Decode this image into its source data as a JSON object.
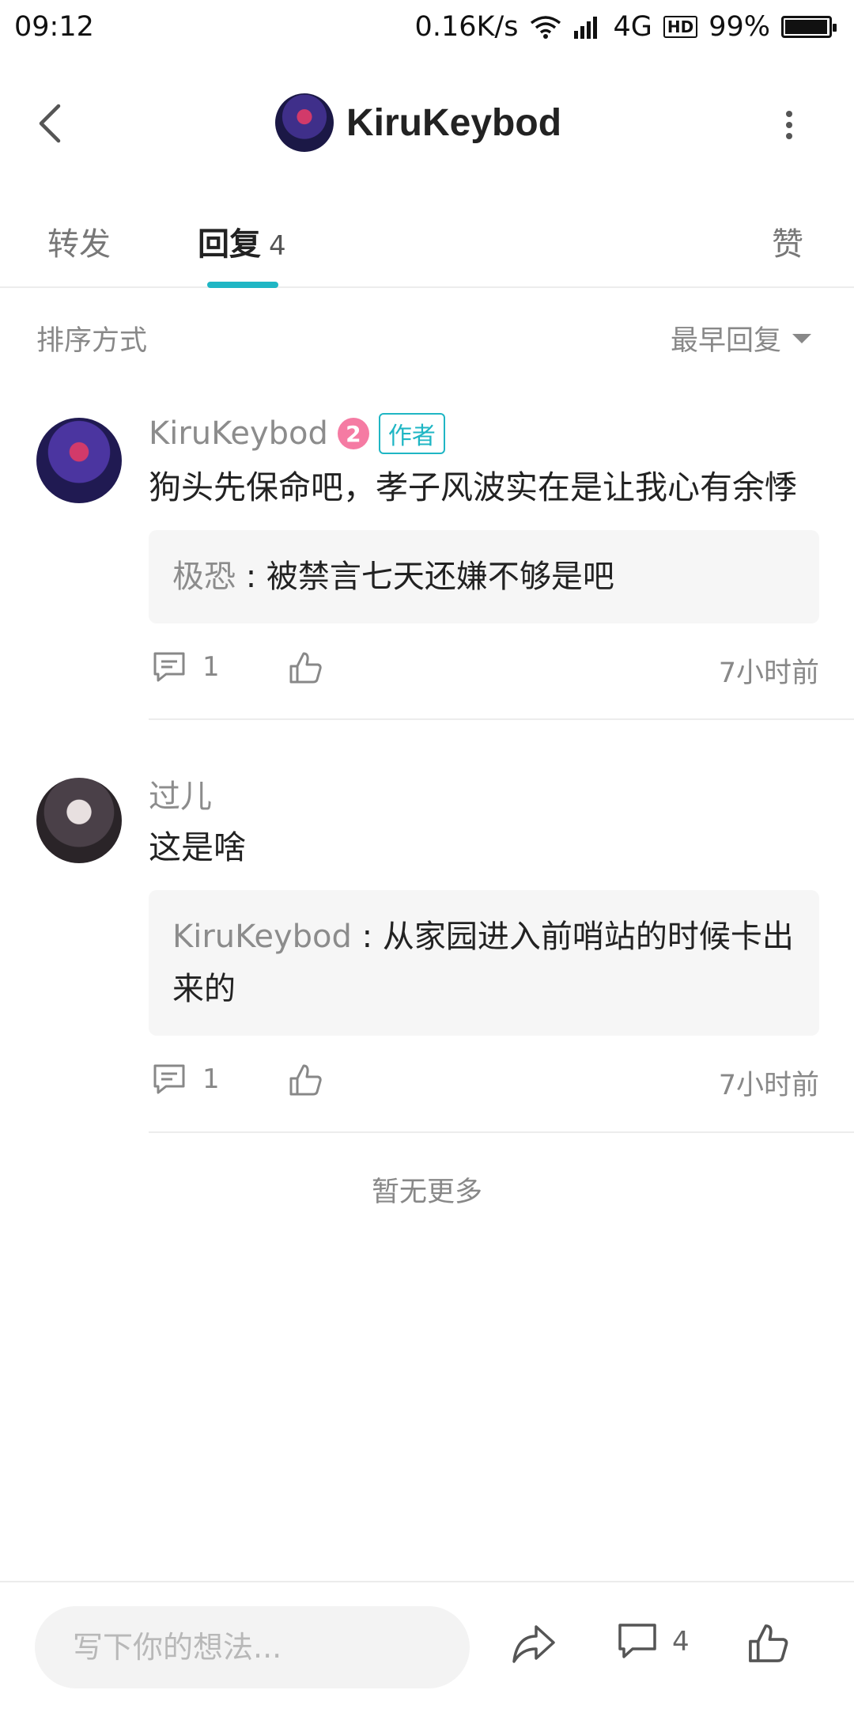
{
  "status_bar": {
    "time": "09:12",
    "speed": "0.16K/s",
    "network": "4G",
    "hd": "HD",
    "battery": "99%",
    "battery_level": 0.99,
    "icons": [
      "wifi-icon",
      "signal-icon",
      "battery-icon"
    ]
  },
  "header": {
    "title": "KiruKeybod",
    "back_icon": "chevron-left-icon",
    "more_icon": "more-vertical-icon"
  },
  "tabs": {
    "forward": "转发",
    "reply": "回复",
    "reply_count": "4",
    "like": "赞",
    "active": "reply",
    "accent": "#1fb6c4"
  },
  "sort": {
    "label": "排序方式",
    "selected": "最早回复"
  },
  "comments": [
    {
      "name": "KiruKeybod",
      "level": "2",
      "badge": "作者",
      "text": "狗头先保命吧，孝子风波实在是让我心有余悸",
      "quote_name": "极恐",
      "quote_sep": " : ",
      "quote_text": "被禁言七天还嫌不够是吧",
      "comment_count": "1",
      "time": "7小时前"
    },
    {
      "name": "过儿",
      "text": "这是啥",
      "quote_name": "KiruKeybod",
      "quote_sep": " : ",
      "quote_text": "从家园进入前哨站的时候卡出来的",
      "comment_count": "1",
      "time": "7小时前"
    }
  ],
  "footer": {
    "no_more": "暂无更多"
  },
  "bottom_bar": {
    "placeholder": "写下你的想法...",
    "comment_count": "4",
    "icons": [
      "share-icon",
      "comment-icon",
      "like-icon"
    ]
  }
}
